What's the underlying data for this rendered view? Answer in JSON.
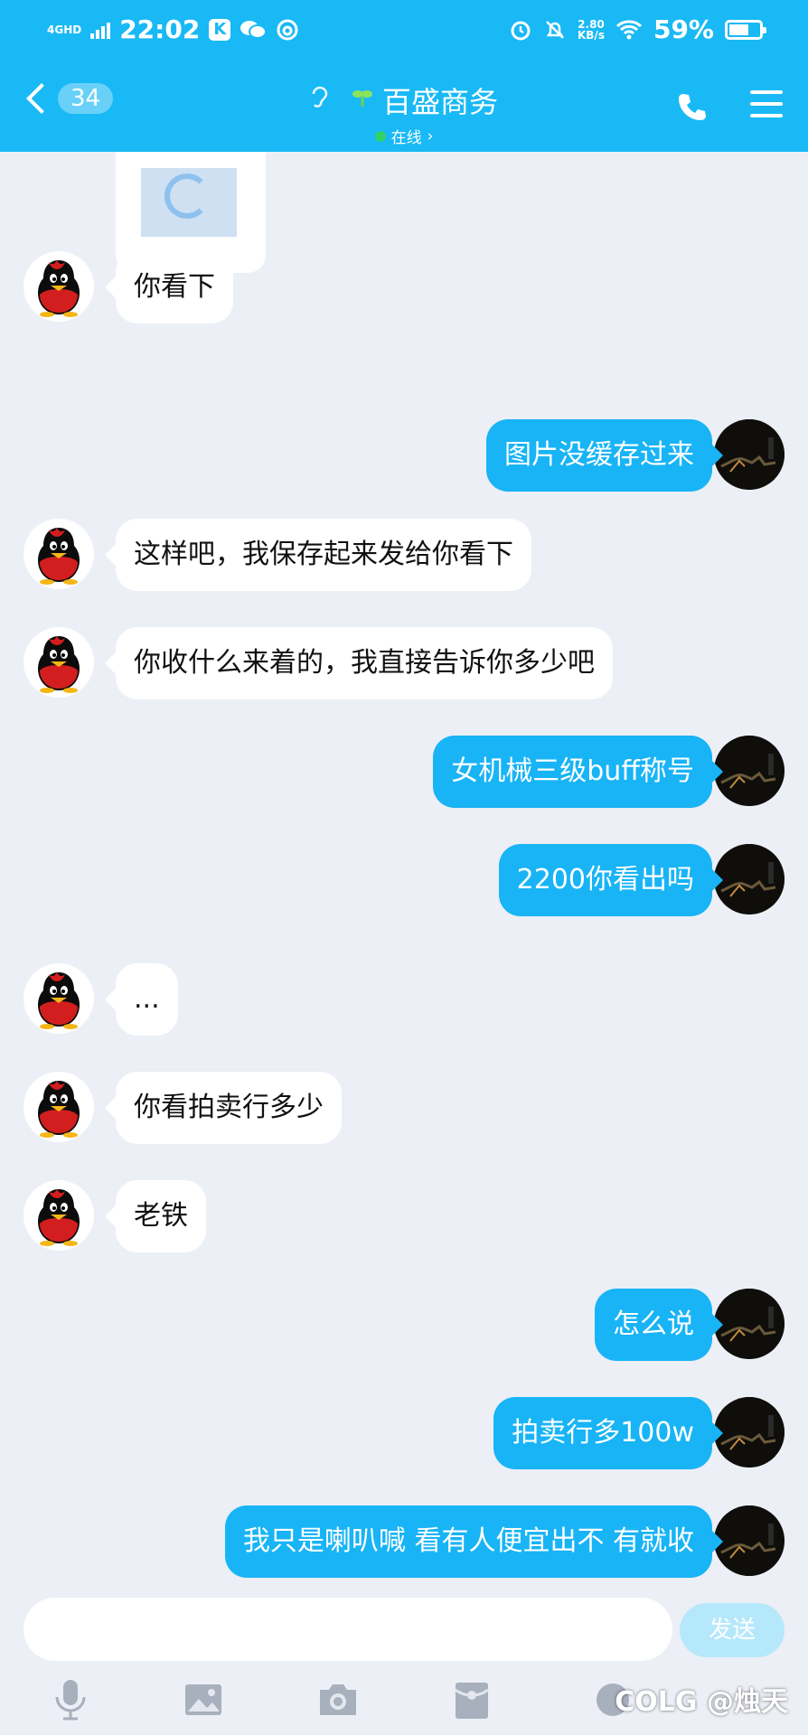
{
  "status_bar": {
    "network": "4GHD",
    "time": "22:02",
    "data_speed_value": "2.80",
    "data_speed_unit": "KB/s",
    "battery": "59%"
  },
  "header": {
    "back_count": "34",
    "contact_name": "百盛商务",
    "status": "在线",
    "status_chevron": "›"
  },
  "messages": [
    {
      "side": "in",
      "text": "你看下"
    },
    {
      "side": "out",
      "text": "图片没缓存过来"
    },
    {
      "side": "in",
      "text": "这样吧，我保存起来发给你看下"
    },
    {
      "side": "in",
      "text": "你收什么来着的，我直接告诉你多少吧"
    },
    {
      "side": "out",
      "text": "女机械三级buff称号"
    },
    {
      "side": "out",
      "text": "2200你看出吗"
    },
    {
      "side": "in",
      "text": "..."
    },
    {
      "side": "in",
      "text": "你看拍卖行多少"
    },
    {
      "side": "in",
      "text": "老铁"
    },
    {
      "side": "out",
      "text": "怎么说"
    },
    {
      "side": "out",
      "text": "拍卖行多100w"
    },
    {
      "side": "out",
      "text": "我只是喇叭喊 看有人便宜出不  有就收"
    }
  ],
  "input": {
    "placeholder": "",
    "send_label": "发送"
  },
  "watermark": "COLG @烛天",
  "colors": {
    "header_bg": "#19b9f5",
    "outgoing_bubble": "#18b4f6",
    "incoming_bubble": "#ffffff",
    "chat_bg": "#eceff6",
    "online_dot": "#2fd36a"
  },
  "icons": {
    "toolbar": [
      "microphone-icon",
      "image-icon",
      "camera-icon",
      "red-packet-icon",
      "emoji-icon"
    ]
  }
}
